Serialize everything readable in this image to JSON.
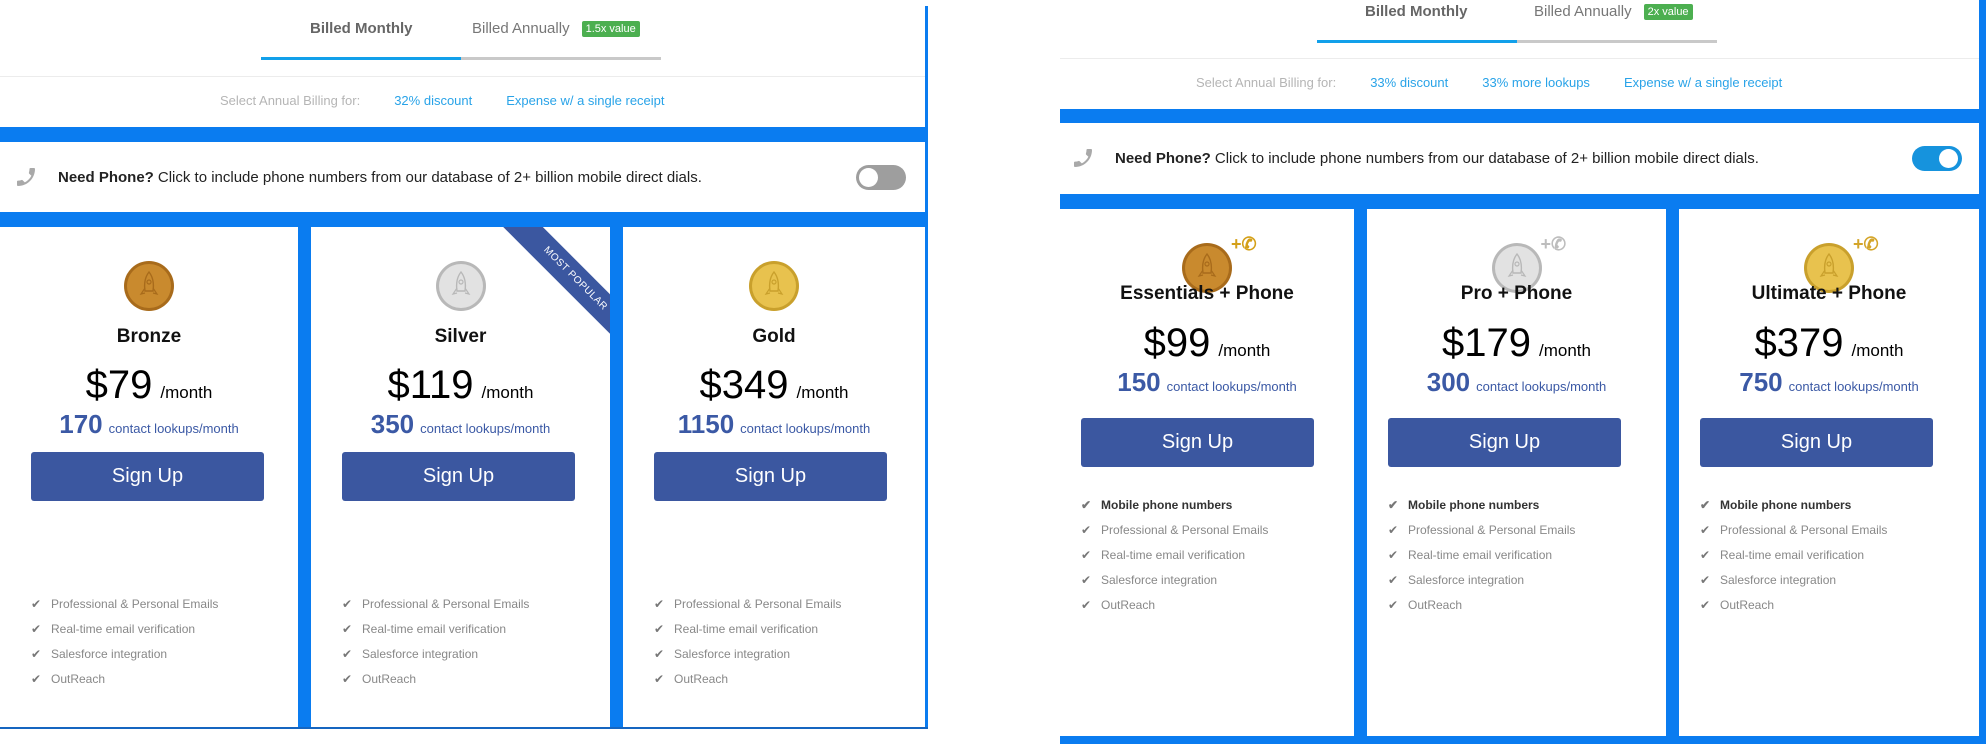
{
  "colors": {
    "page_blue": "#0a7cf0",
    "tab_active": "#12a0ea",
    "tab_inactive": "#c9c9c9",
    "badge_green": "#4caf50",
    "link": "#29a3e8",
    "button": "#3b57a0",
    "lookups": "#3b59a5",
    "toggle_off": "#9e9e9e",
    "toggle_on": "#1693dd"
  },
  "left": {
    "tabs": {
      "monthly": "Billed Monthly",
      "annually": "Billed Annually",
      "badge": "1.5x value"
    },
    "annual_row": {
      "label": "Select Annual Billing for:",
      "links": [
        "32% discount",
        "Expense w/ a single receipt"
      ]
    },
    "phone": {
      "icon": "phone-icon",
      "bold": "Need Phone?",
      "text": "Click to include phone numbers from our database of 2+ billion mobile direct dials.",
      "toggle_on": false
    },
    "plans": [
      {
        "name": "Bronze",
        "coin": "bronze-coin-icon",
        "price": "$79",
        "per": "/month",
        "lookups": "170",
        "lookups_text": "contact lookups/month",
        "button": "Sign Up",
        "ribbon": null,
        "features": [
          "Professional & Personal Emails",
          "Real-time email verification",
          "Salesforce integration",
          "OutReach"
        ]
      },
      {
        "name": "Silver",
        "coin": "silver-coin-icon",
        "price": "$119",
        "per": "/month",
        "lookups": "350",
        "lookups_text": "contact lookups/month",
        "button": "Sign Up",
        "ribbon": "MOST POPULAR",
        "features": [
          "Professional & Personal Emails",
          "Real-time email verification",
          "Salesforce integration",
          "OutReach"
        ]
      },
      {
        "name": "Gold",
        "coin": "gold-coin-icon",
        "price": "$349",
        "per": "/month",
        "lookups": "1150",
        "lookups_text": "contact lookups/month",
        "button": "Sign Up",
        "ribbon": null,
        "features": [
          "Professional & Personal Emails",
          "Real-time email verification",
          "Salesforce integration",
          "OutReach"
        ]
      }
    ]
  },
  "right": {
    "tabs": {
      "monthly": "Billed Monthly",
      "annually": "Billed Annually",
      "badge": "2x value"
    },
    "annual_row": {
      "label": "Select Annual Billing for:",
      "links": [
        "33% discount",
        "33% more lookups",
        "Expense w/ a single receipt"
      ]
    },
    "phone": {
      "icon": "phone-icon",
      "bold": "Need Phone?",
      "text": "Click to include phone numbers from our database of 2+ billion mobile direct dials.",
      "toggle_on": true
    },
    "plans": [
      {
        "name": "Essentials + Phone",
        "coin": "bronze-coin-icon",
        "coin_extra": "+✆",
        "price": "$99",
        "per": "/month",
        "lookups": "150",
        "lookups_text": "contact lookups/month",
        "button": "Sign Up",
        "features": [
          "Mobile phone numbers",
          "Professional & Personal Emails",
          "Real-time email verification",
          "Salesforce integration",
          "OutReach"
        ]
      },
      {
        "name": "Pro + Phone",
        "coin": "silver-coin-icon",
        "coin_extra": "+✆",
        "price": "$179",
        "per": "/month",
        "lookups": "300",
        "lookups_text": "contact lookups/month",
        "button": "Sign Up",
        "features": [
          "Mobile phone numbers",
          "Professional & Personal Emails",
          "Real-time email verification",
          "Salesforce integration",
          "OutReach"
        ]
      },
      {
        "name": "Ultimate + Phone",
        "coin": "gold-coin-icon",
        "coin_extra": "+✆",
        "price": "$379",
        "per": "/month",
        "lookups": "750",
        "lookups_text": "contact lookups/month",
        "button": "Sign Up",
        "features": [
          "Mobile phone numbers",
          "Professional & Personal Emails",
          "Real-time email verification",
          "Salesforce integration",
          "OutReach"
        ]
      }
    ]
  }
}
